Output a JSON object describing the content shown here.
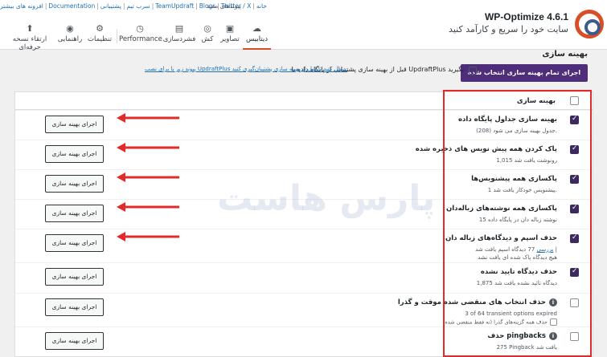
{
  "header": {
    "app_title": "WP-Optimize 4.6.1",
    "app_subtitle": "سایت خود را سریع و کارآمد کنید",
    "quick_links_label": "پیوندهای مفید",
    "top_links": [
      "خانه",
      "Twitter / X",
      "Blogs",
      "TeamUpdraft",
      "پشتیبانی",
      "سرب تیم",
      "Documentation",
      "افزونه های بیشتر"
    ],
    "tabs": [
      {
        "label": "دیتابیس",
        "icon": "cloud-icon",
        "active": true
      },
      {
        "label": "تصاویر",
        "icon": "image-icon",
        "active": false
      },
      {
        "label": "کش",
        "icon": "cache-icon",
        "active": false
      },
      {
        "label": "فشردسازی",
        "icon": "compress-icon",
        "active": false
      },
      {
        "label": "Performance",
        "icon": "performance-icon",
        "active": false
      },
      {
        "label": "تنظیمات",
        "icon": "settings-icon",
        "active": false
      },
      {
        "label": "راهنمایی",
        "icon": "help-icon",
        "active": false
      },
      {
        "label": "ارتقاء نسخه حرفه‌ای",
        "icon": "premium-icon",
        "active": false
      }
    ]
  },
  "main": {
    "title": "بهینه سازی",
    "run_all_label": "اجرای تمام بهینه سازی انتخاب شده",
    "notice_text": "قبل از بهینه سازی پشتیبانی از پایگاه داده با UpdraftPlus بگیرید",
    "notice_link": "پیوند زیر با برای نصب UpdraftPlus دنبال کنید تا قبل از بهینه سازی پشتیبان‌گیری کنید.",
    "table_header": "بهینه سازی",
    "run_button_label": "اجرای بهینه سازی",
    "rows": [
      {
        "title": "بهینه سازی جداول پایگاه داده",
        "desc": "جدول بهینه سازی می شود (208).",
        "desc2": "",
        "checked": true,
        "has_button": true,
        "has_arrow": true
      },
      {
        "title": "پاک کردن همه پیش نویس های ذخیره شده",
        "desc": "1,015 رونوشت یافت شد",
        "desc2": "",
        "checked": true,
        "has_button": true,
        "has_arrow": true
      },
      {
        "title": "پاکسازی همه پیشنویس‌ها",
        "desc": "1 پیشنویس خودکار یافت شد.",
        "desc2": "",
        "checked": true,
        "has_button": true,
        "has_arrow": true
      },
      {
        "title": "پاکسازی همه نوشته‌های زباله‌دان",
        "desc": "15 نوشته زباله دان در پایگاه داده",
        "desc2": "",
        "checked": true,
        "has_button": true,
        "has_arrow": true
      },
      {
        "title": "حذف اسپم و دیدگاه‌های زباله دان",
        "desc": "77 دیدگاه اسپم یافت شد |",
        "desc_link": "بررسی",
        "desc2": "هیچ دیدگاه پاک شده ای یافت نشد",
        "checked": true,
        "has_button": true,
        "has_arrow": true
      },
      {
        "title": "حذف دیدگاه تایید نشده",
        "desc": "1,875 دیدگاه تائید نشده یافت شد",
        "desc2": "",
        "checked": true,
        "has_button": true,
        "has_arrow": false
      },
      {
        "title": "حذف انتخاب های منقضی شده موقت و گذرا",
        "desc": "3 of 64 transient options expired",
        "desc2": "",
        "sub_checkbox": "حذف همه گزینه‌های گذرا (نه فقط منقضی شده)",
        "checked": false,
        "has_button": true,
        "has_arrow": false,
        "info": true
      },
      {
        "title": "حذف pingbacks",
        "desc": "275 Pingback یافت شد",
        "desc2": "",
        "checked": false,
        "has_button": true,
        "has_arrow": false,
        "info": true
      }
    ]
  },
  "watermark": "پارس‌ هاست",
  "colors": {
    "accent": "#d94e26",
    "primary": "#4e2e7a",
    "arrow": "#e12a2a",
    "checkbox": "#3c2a5c"
  }
}
